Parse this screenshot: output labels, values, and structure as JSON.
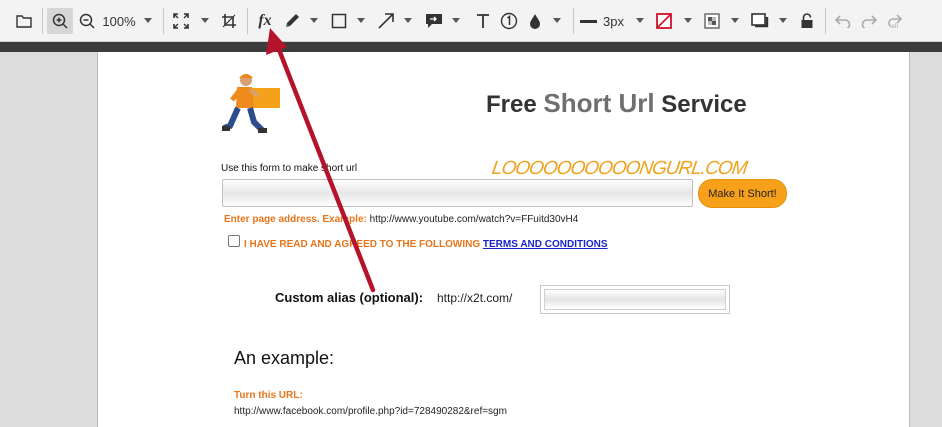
{
  "toolbar": {
    "zoom_level": "100%",
    "stroke_width": "3px",
    "fx_label": "fx",
    "icons": [
      "open-folder-icon",
      "zoom-in-icon",
      "zoom-out-icon",
      "fit-icon",
      "crop-icon",
      "formula-icon",
      "pen-icon",
      "rectangle-icon",
      "arrow-icon",
      "callout-icon",
      "text-icon",
      "counter-icon",
      "blur-icon",
      "line-width-icon",
      "no-color-icon",
      "fill-pattern-icon",
      "shadow-icon",
      "lock-icon",
      "undo-icon",
      "redo-icon",
      "redo-all-icon"
    ]
  },
  "site": {
    "logo_text": "LOOOOOOOOOONGURL.COM",
    "title_part1": "Free ",
    "title_highlight": "Short Url",
    "title_part2": " Service",
    "form_hint": "Use this form to make short url",
    "url_input_value": "",
    "shorten_button": "Make It Short!",
    "example_label": "Enter page address. Example:",
    "example_url": "http://www.youtube.com/watch?v=FFuitd30vH4",
    "agree_text": "I HAVE READ AND AGREED TO THE FOLLOWING",
    "terms_link": "TERMS AND CONDITIONS",
    "alias_label": "Custom alias (optional):",
    "alias_prefix": "http://x2t.com/",
    "alias_value": "",
    "example_heading": "An example:",
    "turn_label": "Turn this URL:",
    "long_url": "http://www.facebook.com/profile.php?id=728490282&ref=sgm"
  },
  "colors": {
    "accent_orange": "#f7a11b",
    "label_orange": "#e8751a",
    "link_blue": "#1a23c9",
    "annotation_arrow": "#b5132b"
  }
}
